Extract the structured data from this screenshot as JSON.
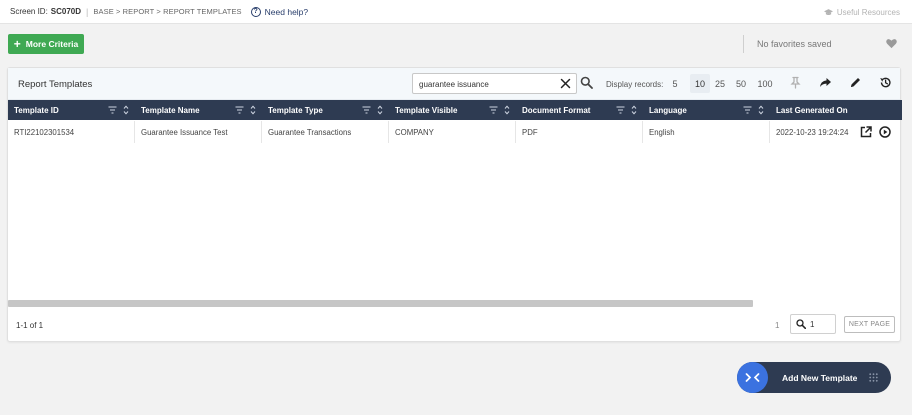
{
  "topbar": {
    "screen_id_label": "Screen ID:",
    "screen_id": "SC070D",
    "breadcrumb": "BASE > REPORT > REPORT TEMPLATES",
    "help": "Need help?",
    "useful_resources": "Useful Resources"
  },
  "toolbar": {
    "more_criteria": "More Criteria",
    "no_favorites": "No favorites saved"
  },
  "card": {
    "title": "Report Templates",
    "search_value": "guarantee issuance",
    "display_label": "Display records:",
    "page_sizes": [
      "5",
      "10",
      "25",
      "50",
      "100"
    ],
    "active_page_size": "10"
  },
  "table": {
    "columns": [
      "Template ID",
      "Template Name",
      "Template Type",
      "Template Visible",
      "Document Format",
      "Language",
      "Last Generated On"
    ],
    "rows": [
      [
        "RTI22102301534",
        "Guarantee Issuance Test",
        "Guarantee Transactions",
        "COMPANY",
        "PDF",
        "English",
        "2022-10-23 19:24:24"
      ]
    ]
  },
  "pagination": {
    "count": "1-1 of 1",
    "current_page": "1",
    "jump_value": "1",
    "next_label": "NEXT PAGE"
  },
  "fab": {
    "label": "Add New Template"
  },
  "colors": {
    "header": "#2e3b52",
    "accent_green": "#3fa953",
    "accent_blue": "#3b72e0"
  }
}
